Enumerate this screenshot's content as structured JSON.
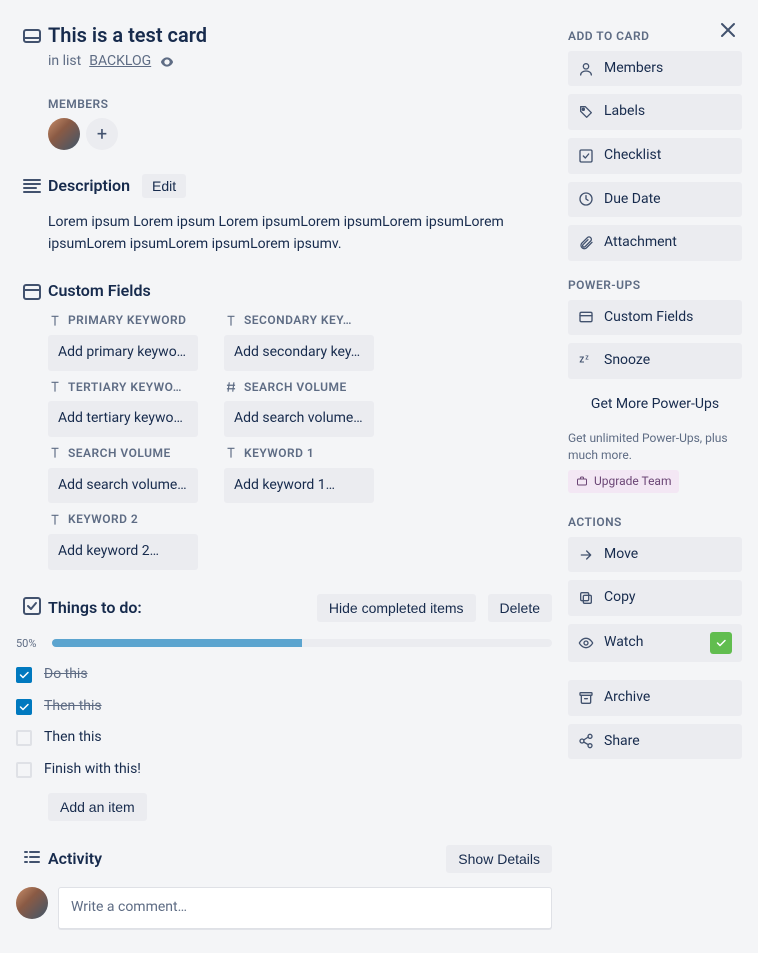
{
  "header": {
    "title": "This is a test card",
    "in_list_prefix": "in list",
    "list_name": "BACKLOG"
  },
  "members": {
    "label": "MEMBERS"
  },
  "description": {
    "title": "Description",
    "edit_label": "Edit",
    "text": "Lorem ipsum Lorem ipsum Lorem ipsumLorem ipsumLorem ipsumLorem ipsumLorem ipsumLorem ipsumLorem ipsumv."
  },
  "custom_fields": {
    "title": "Custom Fields",
    "items": [
      {
        "label": "PRIMARY KEYWORD",
        "icon": "text",
        "placeholder": "Add primary keywo…"
      },
      {
        "label": "SECONDARY KEY…",
        "icon": "text",
        "placeholder": "Add secondary key…"
      },
      {
        "label": "TERTIARY KEYWO…",
        "icon": "text",
        "placeholder": "Add tertiary keywo…"
      },
      {
        "label": "SEARCH VOLUME",
        "icon": "number",
        "placeholder": "Add search volume…"
      },
      {
        "label": "SEARCH VOLUME",
        "icon": "text",
        "placeholder": "Add search volume…"
      },
      {
        "label": "KEYWORD 1",
        "icon": "text",
        "placeholder": "Add keyword 1…"
      },
      {
        "label": "KEYWORD 2",
        "icon": "text",
        "placeholder": "Add keyword 2…"
      }
    ]
  },
  "checklist": {
    "title": "Things to do:",
    "hide_label": "Hide completed items",
    "delete_label": "Delete",
    "progress_pct": "50%",
    "progress_value": 50,
    "items": [
      {
        "text": "Do this",
        "done": true
      },
      {
        "text": "Then this",
        "done": true
      },
      {
        "text": "Then this",
        "done": false
      },
      {
        "text": "Finish with this!",
        "done": false
      }
    ],
    "add_item_label": "Add an item"
  },
  "activity": {
    "title": "Activity",
    "show_details_label": "Show Details",
    "comment_placeholder": "Write a comment…"
  },
  "sidebar": {
    "add_heading": "ADD TO CARD",
    "add_items": [
      {
        "key": "members",
        "label": "Members",
        "icon": "user"
      },
      {
        "key": "labels",
        "label": "Labels",
        "icon": "tag"
      },
      {
        "key": "checklist",
        "label": "Checklist",
        "icon": "check"
      },
      {
        "key": "duedate",
        "label": "Due Date",
        "icon": "clock"
      },
      {
        "key": "attachment",
        "label": "Attachment",
        "icon": "clip"
      }
    ],
    "powerups_heading": "POWER-UPS",
    "powerups": [
      {
        "key": "customfields",
        "label": "Custom Fields",
        "icon": "card"
      },
      {
        "key": "snooze",
        "label": "Snooze",
        "icon": "zz"
      }
    ],
    "get_more_label": "Get More Power-Ups",
    "powerups_note": "Get unlimited Power-Ups, plus much more.",
    "upgrade_label": "Upgrade Team",
    "actions_heading": "ACTIONS",
    "actions": [
      {
        "key": "move",
        "label": "Move",
        "icon": "arrow"
      },
      {
        "key": "copy",
        "label": "Copy",
        "icon": "copy"
      },
      {
        "key": "watch",
        "label": "Watch",
        "icon": "eye",
        "watching": true
      }
    ],
    "actions2": [
      {
        "key": "archive",
        "label": "Archive",
        "icon": "archive"
      },
      {
        "key": "share",
        "label": "Share",
        "icon": "share"
      }
    ]
  }
}
